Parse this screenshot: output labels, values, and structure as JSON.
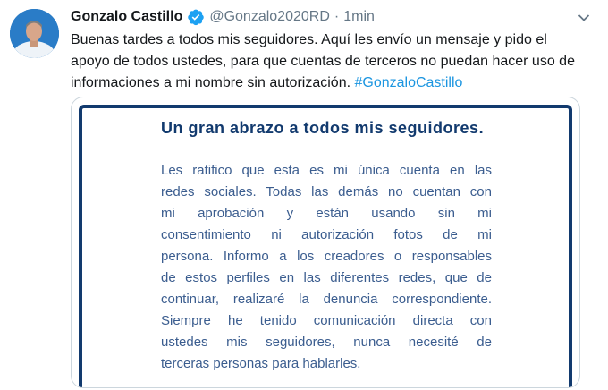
{
  "tweet": {
    "author_name": "Gonzalo Castillo",
    "handle": "@Gonzalo2020RD",
    "separator": "·",
    "time": "1min",
    "text": "Buenas tardes a todos mis seguidores. Aquí les envío un mensaje y pido el apoyo de todos ustedes, para que cuentas de terceros no puedan hacer uso de informaciones a mi nombre sin autorización. ",
    "hashtag": "#GonzaloCastillo",
    "icons": [
      "avatar",
      "verified-badge-icon",
      "chevron-down-icon"
    ],
    "colors": {
      "verified": "#1da1f2",
      "hashtag": "#1b95e0",
      "media_title": "#123a6e",
      "media_text": "#3b5d8f"
    }
  },
  "media": {
    "title": "Un gran abrazo a todos mis seguidores.",
    "lines": [
      "Les ratifico que esta es mi única cuenta en las",
      "redes sociales. Todas las demás no cuentan con",
      "mi aprobación y están usando sin mi",
      "consentimiento ni autorización fotos de mi",
      "persona. Informo a los creadores o responsables",
      "de estos perfiles en las diferentes redes, que de",
      "continuar, realizaré la denuncia correspondiente.",
      "Siempre he tenido comunicación directa con",
      "ustedes mis seguidores, nunca necesité de",
      "terceras personas para hablarles."
    ]
  }
}
